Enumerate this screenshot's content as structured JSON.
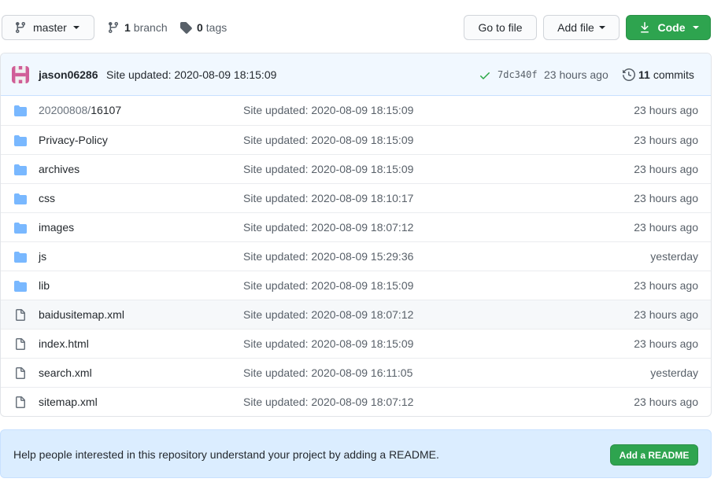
{
  "toolbar": {
    "branch_selector": "master",
    "branches_count": "1",
    "branches_label": "branch",
    "tags_count": "0",
    "tags_label": "tags",
    "go_to_file": "Go to file",
    "add_file": "Add file",
    "code": "Code"
  },
  "commit": {
    "author": "jason06286",
    "message": "Site updated: 2020-08-09 18:15:09",
    "sha": "7dc340f",
    "time": "23 hours ago",
    "commits_count": "11",
    "commits_label": "commits"
  },
  "files": [
    {
      "type": "folder",
      "prefix": "20200808/",
      "name": "16107",
      "message": "Site updated: 2020-08-09 18:15:09",
      "time": "23 hours ago"
    },
    {
      "type": "folder",
      "prefix": "",
      "name": "Privacy-Policy",
      "message": "Site updated: 2020-08-09 18:15:09",
      "time": "23 hours ago"
    },
    {
      "type": "folder",
      "prefix": "",
      "name": "archives",
      "message": "Site updated: 2020-08-09 18:15:09",
      "time": "23 hours ago"
    },
    {
      "type": "folder",
      "prefix": "",
      "name": "css",
      "message": "Site updated: 2020-08-09 18:10:17",
      "time": "23 hours ago"
    },
    {
      "type": "folder",
      "prefix": "",
      "name": "images",
      "message": "Site updated: 2020-08-09 18:07:12",
      "time": "23 hours ago"
    },
    {
      "type": "folder",
      "prefix": "",
      "name": "js",
      "message": "Site updated: 2020-08-09 15:29:36",
      "time": "yesterday"
    },
    {
      "type": "folder",
      "prefix": "",
      "name": "lib",
      "message": "Site updated: 2020-08-09 18:15:09",
      "time": "23 hours ago"
    },
    {
      "type": "file",
      "prefix": "",
      "name": "baidusitemap.xml",
      "message": "Site updated: 2020-08-09 18:07:12",
      "time": "23 hours ago"
    },
    {
      "type": "file",
      "prefix": "",
      "name": "index.html",
      "message": "Site updated: 2020-08-09 18:15:09",
      "time": "23 hours ago"
    },
    {
      "type": "file",
      "prefix": "",
      "name": "search.xml",
      "message": "Site updated: 2020-08-09 16:11:05",
      "time": "yesterday"
    },
    {
      "type": "file",
      "prefix": "",
      "name": "sitemap.xml",
      "message": "Site updated: 2020-08-09 18:07:12",
      "time": "23 hours ago"
    }
  ],
  "readme_banner": {
    "text": "Help people interested in this repository understand your project by adding a README.",
    "button": "Add a README"
  },
  "colors": {
    "primary_green": "#2ea44f",
    "folder_blue": "#79b8ff",
    "commit_header_bg": "#f1f8ff",
    "readme_bg": "#dbedff"
  },
  "icons": {
    "branch": "git-branch-icon",
    "tag": "tag-icon",
    "download": "download-icon",
    "check": "check-icon",
    "history": "history-icon",
    "folder": "folder-icon",
    "file": "file-icon"
  }
}
